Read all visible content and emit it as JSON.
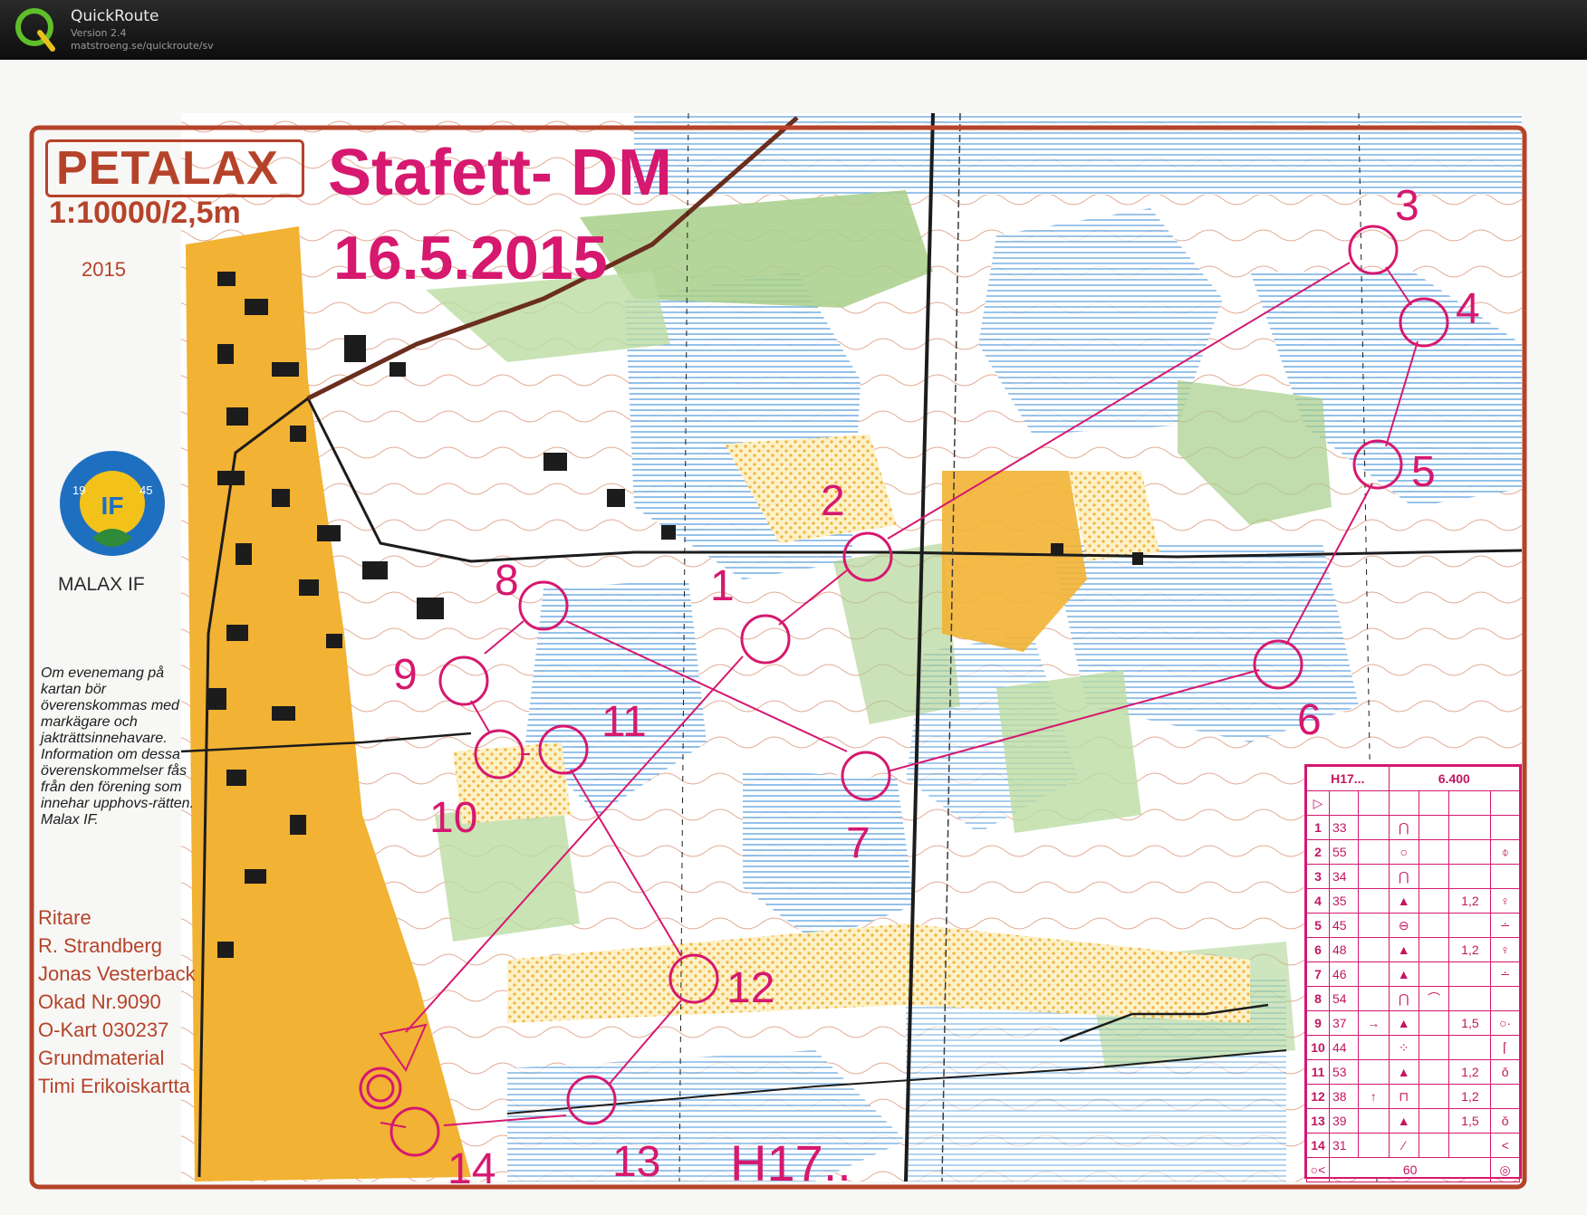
{
  "app": {
    "name": "QuickRoute",
    "version": "Version 2.4",
    "url": "matstroeng.se/quickroute/sv",
    "logo_letter": "Q"
  },
  "map": {
    "name": "PETALAX",
    "scale": "1:10000/2,5m",
    "year": "2015",
    "event": "Stafett- DM",
    "date": "16.5.2015",
    "club": "MALAX IF",
    "club_logo": {
      "years_left": "19",
      "years_right": "45",
      "letters": "IF"
    },
    "note": "Om evenemang på kartan bör överenskommas med markägare och jakträttsinnehavare. Information om dessa överenskommelser fås från den förening som innehar upphovs-rätten. Malax IF.",
    "credits": [
      "Ritare",
      "R. Strandberg",
      "Jonas Vesterback",
      "Okad Nr.9090",
      "O-Kart 030237",
      "Grundmaterial",
      "Timi Erikoiskartta"
    ],
    "course_label": "H17..",
    "controls": [
      "1",
      "2",
      "3",
      "4",
      "5",
      "6",
      "7",
      "8",
      "9",
      "10",
      "11",
      "12",
      "13",
      "14"
    ]
  },
  "description_sheet": {
    "class": "H17...",
    "length": "6.400",
    "footer": "60",
    "rows": [
      {
        "num": "1",
        "code": "33"
      },
      {
        "num": "2",
        "code": "55"
      },
      {
        "num": "3",
        "code": "34"
      },
      {
        "num": "4",
        "code": "35",
        "extra": "1,2"
      },
      {
        "num": "5",
        "code": "45"
      },
      {
        "num": "6",
        "code": "48",
        "extra": "1,2"
      },
      {
        "num": "7",
        "code": "46"
      },
      {
        "num": "8",
        "code": "54"
      },
      {
        "num": "9",
        "code": "37",
        "extra": "1,5"
      },
      {
        "num": "10",
        "code": "44"
      },
      {
        "num": "11",
        "code": "53",
        "extra": "1,2"
      },
      {
        "num": "12",
        "code": "38",
        "extra": "1,2"
      },
      {
        "num": "13",
        "code": "39",
        "extra": "1,5"
      },
      {
        "num": "14",
        "code": "31"
      }
    ]
  },
  "colors": {
    "course": "#d6186f",
    "border": "#b5432a",
    "yellow": "#f2b233",
    "blue": "#5aa9e6",
    "green": "#a8cf8a"
  }
}
